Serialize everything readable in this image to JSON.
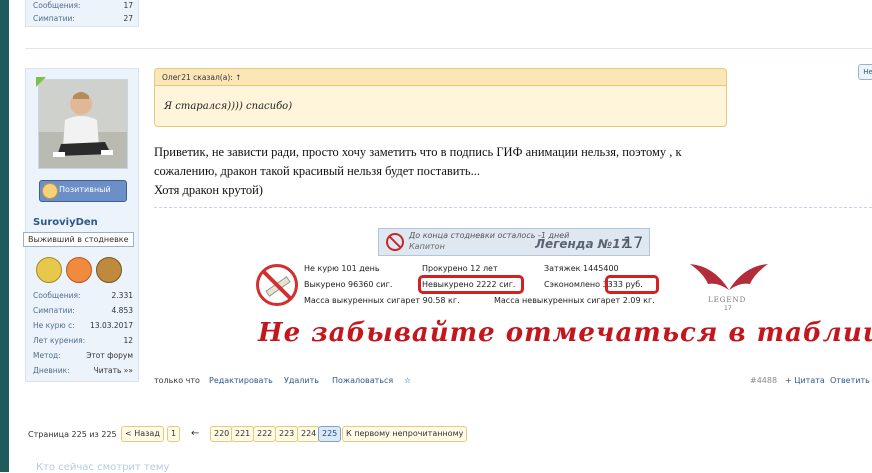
{
  "prev_stats": [
    {
      "label": "Сообщения:",
      "value": "17"
    },
    {
      "label": "Симпатии:",
      "value": "27"
    }
  ],
  "quote": {
    "header": "Олег21 сказал(а): ↑",
    "text": "Я старался)))) спасибо)"
  },
  "message": {
    "line1": "Приветик, не зависти ради, просто хочу заметить что в подпись ГИФ анимации нельзя, поэтому , к",
    "line2": "сожалению, дракон такой красивый нельзя будет поставить...",
    "line3": "Хотя дракон крутой)"
  },
  "user": {
    "positive_label": "Позитивный",
    "username": "SuroviyDen",
    "title": "Выживший в стодневке",
    "stats": [
      {
        "label": "Сообщения:",
        "value": "2.331"
      },
      {
        "label": "Симпатии:",
        "value": "4.853"
      },
      {
        "label": "Не курю с:",
        "value": "13.03.2017"
      },
      {
        "label": "Лет курения:",
        "value": "12"
      },
      {
        "label": "Метод:",
        "value": "Этот форум"
      },
      {
        "label": "Дневник:",
        "value": "Читать »»"
      }
    ]
  },
  "signature": {
    "banner_line1": "До конца стодневки осталось -1 дней",
    "banner_line2": "Капитон",
    "banner_legend": "Легенда №17",
    "banner_number": "17",
    "c_notsmoke": "Не курю 101 день",
    "c_smoked": "Прокурено 12 лет",
    "c_puffs": "Затяжек 1445400",
    "c_smoked_cigs": "Выкурено 96360 сиг.",
    "c_not_smoked": "Невыкурено 2222 сиг.",
    "c_saved": "Сэкономлено 3333 руб.",
    "c_mass_smoked": "Масса выкуренных сигарет 90.58 кг.",
    "c_mass_not": "Масса невыкуренных сигарет 2.09 кг.",
    "logo_text": "LEGEND",
    "logo_number": "17",
    "script_text": "Не забывайте отмечаться в таблице!"
  },
  "post_footer": {
    "prefix": "только что",
    "edit": "Редактировать",
    "delete": "Удалить",
    "report": "Пожаловаться",
    "star": "☆",
    "post_no": "#4488",
    "quote": "+ Цитата",
    "reply": "Ответить"
  },
  "pagination": {
    "label": "Страница 225 из 225",
    "prev": "< Назад",
    "first": "1",
    "arrow": "←",
    "pages": [
      "220",
      "221",
      "222",
      "223",
      "224",
      "225"
    ],
    "unread": "К первому непрочитанному"
  },
  "watching": "Кто сейчас смотрит тему",
  "side_button": "Не"
}
